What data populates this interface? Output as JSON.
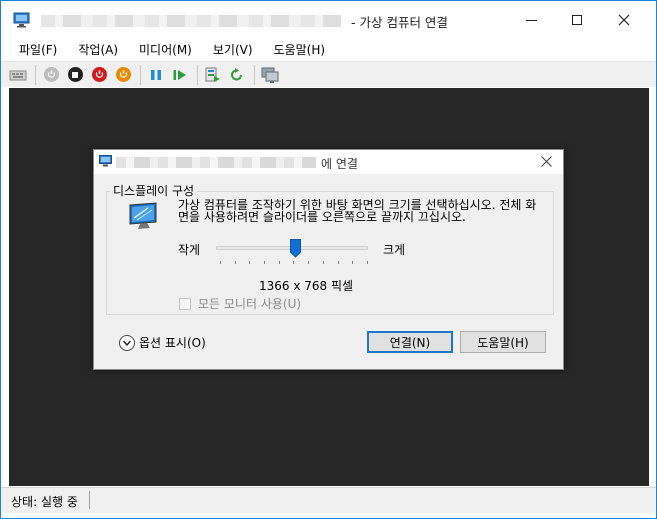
{
  "window": {
    "title_suffix": "- 가상 컴퓨터 연결"
  },
  "menu": {
    "items": [
      "파일(F)",
      "작업(A)",
      "미디어(M)",
      "보기(V)",
      "도움말(H)"
    ]
  },
  "toolbar": {
    "icons": [
      "ctrl-alt-del-icon",
      "start-icon",
      "turn-off-icon",
      "shut-down-icon",
      "save-icon",
      "pause-icon",
      "resume-icon",
      "checkpoint-icon",
      "revert-icon",
      "enhanced-session-icon"
    ]
  },
  "status": {
    "text": "상태: 실행 중"
  },
  "dialog": {
    "title_suffix": "에 연결",
    "group_label": "디스플레이 구성",
    "description": "가상 컴퓨터를 조작하기 위한 바탕 화면의 크기를 선택하십시오. 전체 화면을 사용하려면 슬라이더를 오른쪽으로 끝까지 끄십시오.",
    "small_label": "작게",
    "large_label": "크게",
    "resolution": "1366 x 768 픽셀",
    "slider_position": 0.52,
    "multi_monitor_label": "모든 모니터 사용(U)",
    "multi_monitor_checked": false,
    "options_label": "옵션 표시(O)",
    "connect_label": "연결(N)",
    "help_label": "도움말(H)"
  },
  "colors": {
    "accent": "#1f76c8",
    "viewport": "#272727"
  }
}
